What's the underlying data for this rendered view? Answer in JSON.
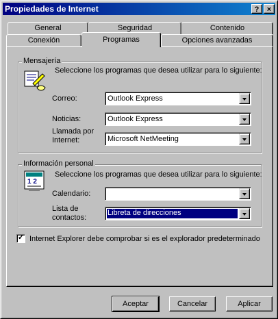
{
  "window": {
    "title": "Propiedades de Internet",
    "help_glyph": "?",
    "close_glyph": "×"
  },
  "tabs": {
    "row_back": [
      "General",
      "Seguridad",
      "Contenido"
    ],
    "row_front": [
      "Conexión",
      "Programas",
      "Opciones avanzadas"
    ],
    "active": "Programas"
  },
  "messaging": {
    "title": "Mensajería",
    "description": "Seleccione los programas que desea utilizar para lo siguiente:",
    "rows": [
      {
        "label": "Correo:",
        "value": "Outlook Express"
      },
      {
        "label": "Noticias:",
        "value": "Outlook Express"
      },
      {
        "label_line1": "Llamada por",
        "label_line2": "Internet:",
        "value": "Microsoft NetMeeting"
      }
    ]
  },
  "personal": {
    "title": "Información personal",
    "description": "Seleccione los programas que desea utilizar para lo siguiente:",
    "calendar_label": "Calendario:",
    "calendar_value": "",
    "contacts_label_line1": "Lista de",
    "contacts_label_line2": "contactos:",
    "contacts_value": "Libreta de direcciones"
  },
  "check_default": {
    "checked": true,
    "label": "Internet Explorer debe comprobar si es el explorador predeterminado"
  },
  "buttons": {
    "ok": "Aceptar",
    "cancel": "Cancelar",
    "apply": "Aplicar"
  }
}
